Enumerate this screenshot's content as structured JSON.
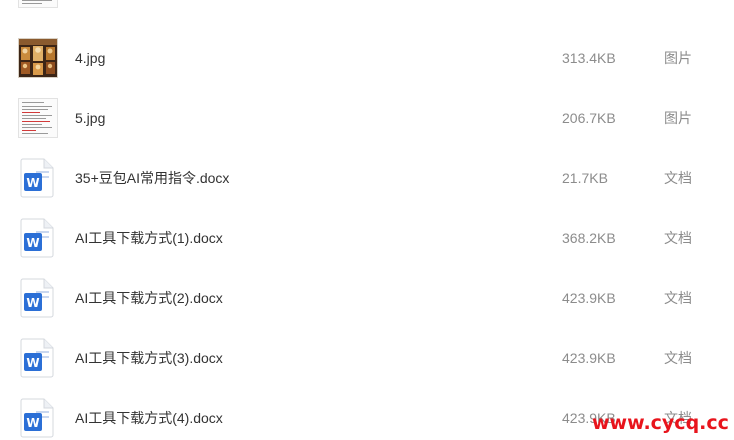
{
  "files": [
    {
      "name": "",
      "size": "",
      "type": ""
    },
    {
      "name": "4.jpg",
      "size": "313.4KB",
      "type": "图片"
    },
    {
      "name": "5.jpg",
      "size": "206.7KB",
      "type": "图片"
    },
    {
      "name": "35+豆包AI常用指令.docx",
      "size": "21.7KB",
      "type": "文档"
    },
    {
      "name": "AI工具下载方式(1).docx",
      "size": "368.2KB",
      "type": "文档"
    },
    {
      "name": "AI工具下载方式(2).docx",
      "size": "423.9KB",
      "type": "文档"
    },
    {
      "name": "AI工具下载方式(3).docx",
      "size": "423.9KB",
      "type": "文档"
    },
    {
      "name": "AI工具下载方式(4).docx",
      "size": "423.9KB",
      "type": "文档"
    }
  ],
  "icons": {
    "image_doc": "image-file-thumbnail-icon",
    "image_photo": "photo-thumbnail-icon",
    "word": "word-document-icon"
  },
  "colors": {
    "word_blue": "#2b6fd6",
    "text": "#333333",
    "meta": "#8c8c8c",
    "watermark": "#e8141c"
  },
  "watermark": "www.cycq.cc"
}
